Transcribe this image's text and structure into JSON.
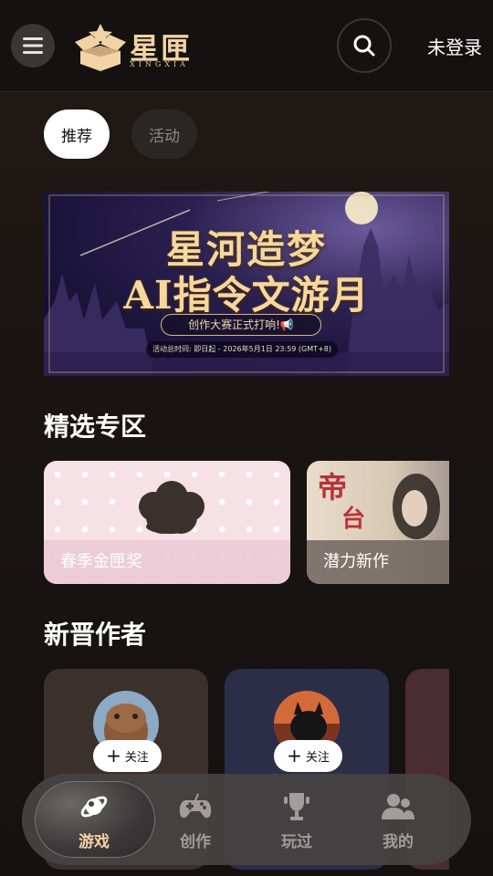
{
  "header": {
    "logo_text": "星匣",
    "logo_sub": "XINGXIA",
    "login_label": "未登录"
  },
  "tabs": [
    {
      "label": "推荐",
      "active": true
    },
    {
      "label": "活动",
      "active": false
    }
  ],
  "banner": {
    "title_line1": "星河造梦",
    "title_line2": "AI指令文游月",
    "subtitle": "创作大赛正式打响!📢",
    "time_text": "活动总时间: 即日起 - 2026年5月1日 23:59 (GMT+8)"
  },
  "featured": {
    "title": "精选专区",
    "cards": [
      {
        "label": "春季金匣奖"
      },
      {
        "label": "潜力新作"
      }
    ]
  },
  "authors": {
    "title": "新晋作者",
    "follow_label": "关注"
  },
  "bottom_nav": [
    {
      "label": "游戏",
      "icon": "planet-icon",
      "active": true
    },
    {
      "label": "创作",
      "icon": "gamepad-icon",
      "active": false
    },
    {
      "label": "玩过",
      "icon": "trophy-icon",
      "active": false
    },
    {
      "label": "我的",
      "icon": "users-icon",
      "active": false
    }
  ],
  "colors": {
    "accent": "#f3d2a6",
    "background": "#141110",
    "nav_bg": "#464242"
  }
}
